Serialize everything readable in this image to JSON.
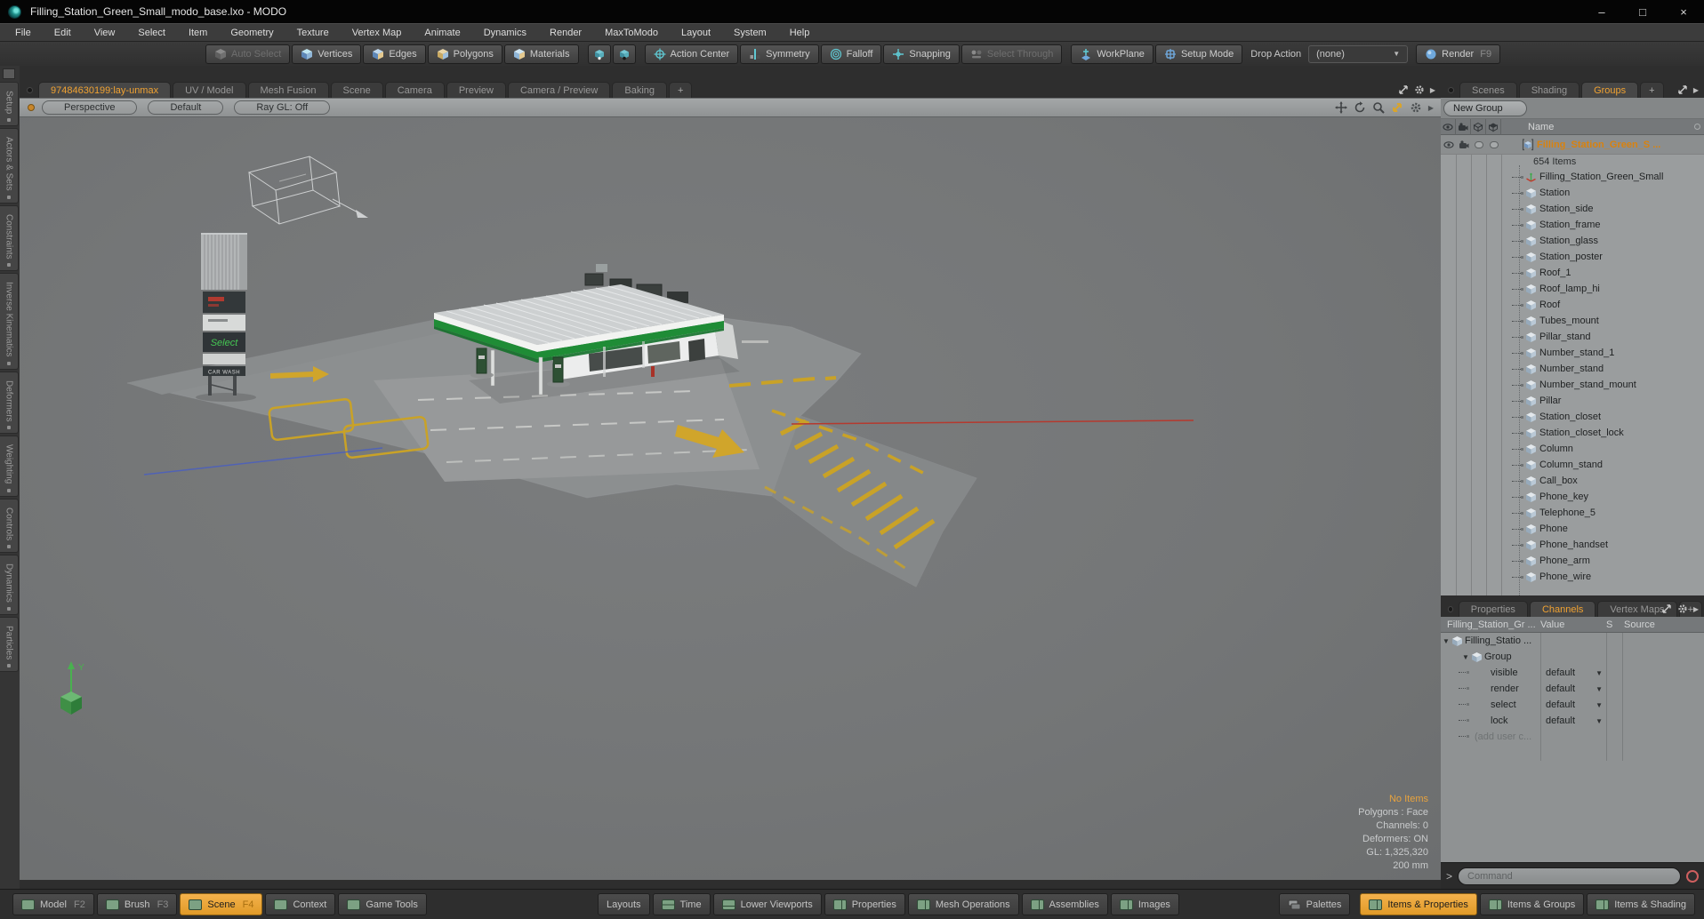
{
  "theme": {
    "accent_orange": "#f0a232",
    "active_button_orange": "#e8a33d",
    "panel_green_icon": "#7ca183",
    "teal_icon": "#5fc8d2",
    "record_red": "#cf5f5f",
    "axis_red": "#b5392e",
    "axis_blue": "#4a5fc0",
    "axis_green": "#49b14f",
    "station_green": "#1f8c36",
    "marking_yellow": "#c9a227"
  },
  "window": {
    "title": "Filling_Station_Green_Small_modo_base.lxo - MODO",
    "minimize_glyph": "–",
    "maximize_glyph": "□",
    "close_glyph": "×"
  },
  "menu": {
    "items": [
      "File",
      "Edit",
      "View",
      "Select",
      "Item",
      "Geometry",
      "Texture",
      "Vertex Map",
      "Animate",
      "Dynamics",
      "Render",
      "MaxToModo",
      "Layout",
      "System",
      "Help"
    ]
  },
  "toolbar": {
    "auto_select": "Auto Select",
    "vertices": "Vertices",
    "edges": "Edges",
    "polygons": "Polygons",
    "materials": "Materials",
    "action_center": "Action Center",
    "symmetry": "Symmetry",
    "falloff": "Falloff",
    "snapping": "Snapping",
    "select_through": "Select Through",
    "workplane": "WorkPlane",
    "setup_mode": "Setup Mode",
    "drop_action": "Drop Action",
    "drop_action_value": "(none)",
    "dropdown_glyph": "▼",
    "render": "Render",
    "render_key": "F9"
  },
  "left_tabs": {
    "items": [
      "Setup",
      "Actors & Sets",
      "Constraints",
      "Inverse Kinematics",
      "Deformers",
      "Weighting",
      "Controls",
      "Dynamics",
      "Particles"
    ]
  },
  "viewport": {
    "tabs": {
      "active": "97484630199:lay-unmax",
      "items": [
        "UV / Model",
        "Mesh Fusion",
        "Scene",
        "Camera",
        "Preview",
        "Camera / Preview",
        "Baking"
      ],
      "add_glyph": "+"
    },
    "header": {
      "view": "Perspective",
      "preset": "Default",
      "raygl": "Ray GL: Off"
    },
    "scene": {
      "sign_text_select": "Select",
      "sign_text_carwash": "CAR WASH",
      "axis_y_label": "Y"
    },
    "overlay": {
      "highlight": "No Items",
      "lines": [
        "Polygons : Face",
        "Channels: 0",
        "Deformers: ON",
        "GL: 1,325,320",
        "200 mm"
      ]
    }
  },
  "groups_panel": {
    "tabs": {
      "items": [
        "Scenes",
        "Shading"
      ],
      "active": "Groups",
      "add_glyph": "+",
      "panel_arrow_glyph": "▶"
    },
    "new_group_button": "New Group",
    "name_header": "Name",
    "group_row": {
      "label": "Filling_Station_Green_S ...",
      "count": "654 Items"
    },
    "locator_item": "Filling_Station_Green_Small",
    "tree_items": [
      "Station",
      "Station_side",
      "Station_frame",
      "Station_glass",
      "Station_poster",
      "Roof_1",
      "Roof_lamp_hi",
      "Roof",
      "Tubes_mount",
      "Pillar_stand",
      "Number_stand_1",
      "Number_stand",
      "Number_stand_mount",
      "Pillar",
      "Station_closet",
      "Station_closet_lock",
      "Column",
      "Column_stand",
      "Call_box",
      "Phone_key",
      "Telephone_5",
      "Phone",
      "Phone_handset",
      "Phone_arm",
      "Phone_wire"
    ]
  },
  "channels_panel": {
    "tabs": {
      "items": [
        "Properties",
        "Vertex Maps"
      ],
      "active": "Channels",
      "add_glyph": "+",
      "panel_arrow_glyph": "▶"
    },
    "headers": {
      "name": "Filling_Station_Gr ...",
      "value": "Value",
      "s": "S",
      "source": "Source"
    },
    "parent_rows": [
      {
        "label": "Filling_Statio ..."
      },
      {
        "label": "Group"
      }
    ],
    "rows": [
      {
        "name": "visible",
        "value": "default"
      },
      {
        "name": "render",
        "value": "default"
      },
      {
        "name": "select",
        "value": "default"
      },
      {
        "name": "lock",
        "value": "default"
      }
    ],
    "add_user_row": "(add user c...",
    "collapse_glyph": "▼",
    "dropdown_glyph": "▼"
  },
  "command_bar": {
    "prompt_glyph": ">",
    "placeholder": "Command"
  },
  "bottom_bar": {
    "left": [
      {
        "label": "Model",
        "fkey": "F2"
      },
      {
        "label": "Brush",
        "fkey": "F3"
      },
      {
        "label": "Scene",
        "fkey": "F4"
      },
      {
        "label": "Context",
        "fkey": ""
      },
      {
        "label": "Game Tools",
        "fkey": ""
      }
    ],
    "center": [
      {
        "label": "Layouts"
      },
      {
        "label": "Time"
      },
      {
        "label": "Lower Viewports"
      },
      {
        "label": "Properties"
      },
      {
        "label": "Mesh Operations"
      },
      {
        "label": "Assemblies"
      },
      {
        "label": "Images"
      }
    ],
    "right": [
      {
        "label": "Palettes"
      },
      {
        "label": "Items & Properties"
      },
      {
        "label": "Items & Groups"
      },
      {
        "label": "Items & Shading"
      }
    ]
  }
}
